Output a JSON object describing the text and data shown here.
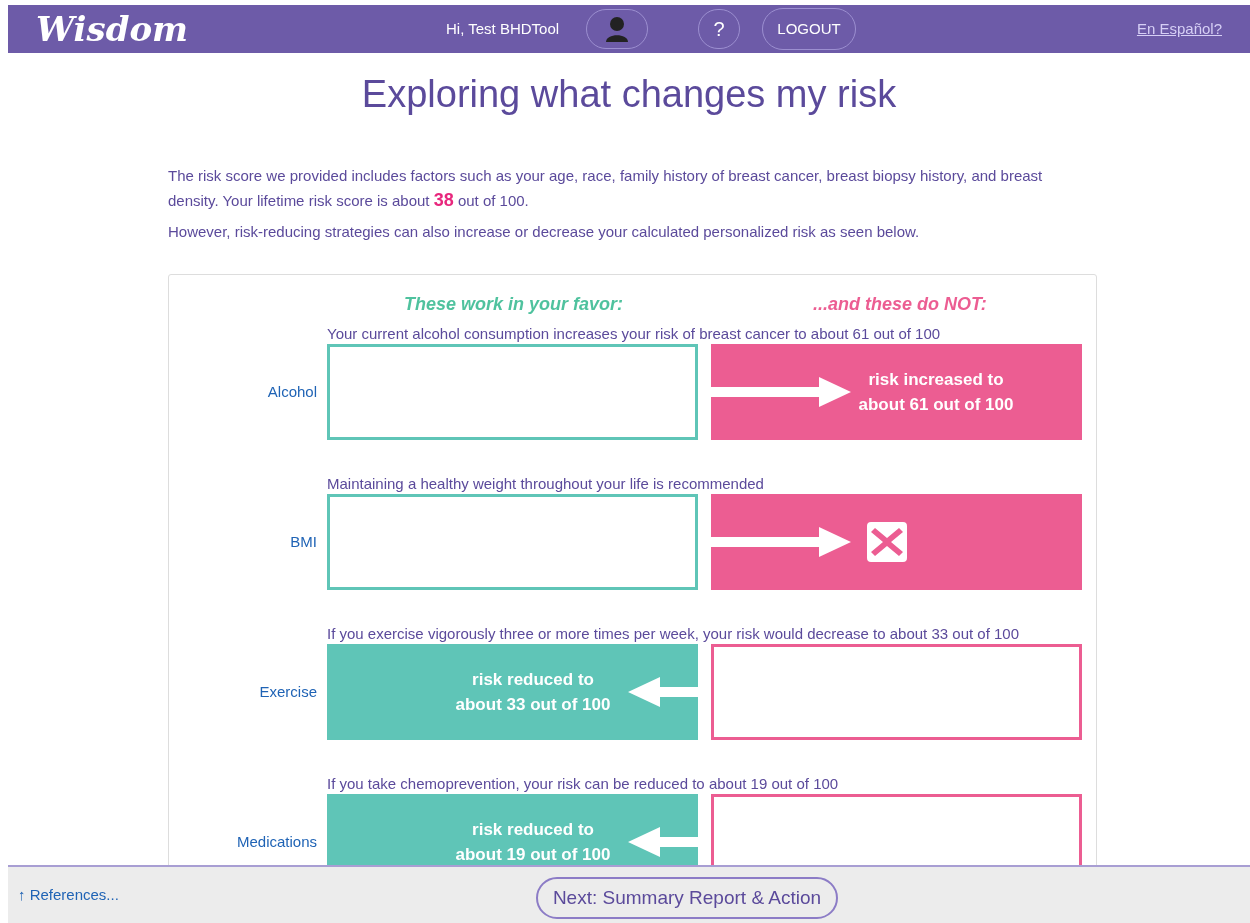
{
  "header": {
    "logo": "Wisdom",
    "greeting": "Hi, Test BHDTool",
    "help": "?",
    "logout": "LOGOUT",
    "language_link": "En Español?"
  },
  "title": "Exploring what changes my risk",
  "intro": [
    "The risk score we provided includes factors such as your age, race, family history of breast cancer, breast biopsy history, and breast density. Your lifetime risk score is about **38** out of 100.",
    "However, risk-reducing strategies can also increase or decrease your calculated personalized risk as seen below."
  ],
  "columns": {
    "favor": "These work in your favor:",
    "against": "...and these do NOT:"
  },
  "rows": [
    {
      "label": "Alcohol",
      "caption": "Your current alcohol consumption increases your risk of breast cancer to about 61 out of 100",
      "kind": "increase",
      "result": "risk increased to about 61 out of 100"
    },
    {
      "label": "BMI",
      "caption": "Maintaining a healthy weight throughout your life is recommended",
      "kind": "cross"
    },
    {
      "label": "Exercise",
      "caption": "If you exercise vigorously three or more times per week, your risk would decrease to about 33 out of 100",
      "kind": "decrease",
      "result": "risk reduced to about 33 out of 100"
    },
    {
      "label": "Medications",
      "caption": "If you take chemoprevention, your risk can be reduced to about 19 out of 100",
      "kind": "decrease",
      "result": "risk reduced to about 19 out of 100"
    }
  ],
  "footer": {
    "references": "↑ References...",
    "next": "Next: Summary Report & Action"
  }
}
